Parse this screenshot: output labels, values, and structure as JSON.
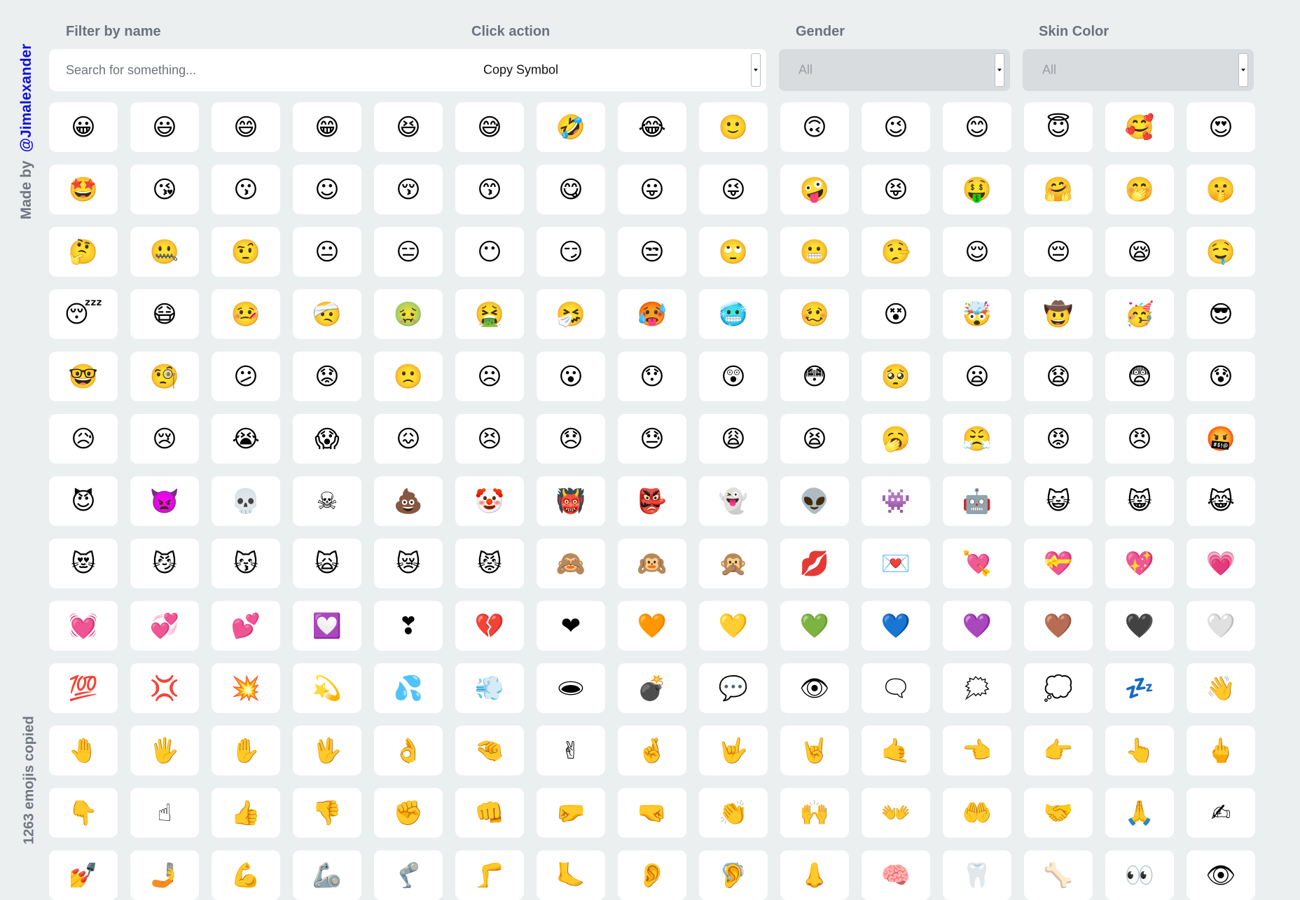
{
  "sidebar": {
    "made_by": "Made by",
    "handle": "@Jimalexander",
    "copied_count": "1263 emojis copied"
  },
  "filters": {
    "filter_label": "Filter by name",
    "search_placeholder": "Search for something...",
    "click_action_label": "Click action",
    "click_action_value": "Copy Symbol",
    "gender_label": "Gender",
    "gender_value": "All",
    "skin_label": "Skin Color",
    "skin_value": "All"
  },
  "emojis": [
    "😀",
    "😃",
    "😄",
    "😁",
    "😆",
    "😅",
    "🤣",
    "😂",
    "🙂",
    "🙃",
    "😉",
    "😊",
    "😇",
    "🥰",
    "😍",
    "🤩",
    "😘",
    "😗",
    "☺",
    "😚",
    "😙",
    "😋",
    "😛",
    "😜",
    "🤪",
    "😝",
    "🤑",
    "🤗",
    "🤭",
    "🤫",
    "🤔",
    "🤐",
    "🤨",
    "😐",
    "😑",
    "😶",
    "😏",
    "😒",
    "🙄",
    "😬",
    "🤥",
    "😌",
    "😔",
    "😪",
    "🤤",
    "😴",
    "😷",
    "🤒",
    "🤕",
    "🤢",
    "🤮",
    "🤧",
    "🥵",
    "🥶",
    "🥴",
    "😵",
    "🤯",
    "🤠",
    "🥳",
    "😎",
    "🤓",
    "🧐",
    "😕",
    "😟",
    "🙁",
    "☹",
    "😮",
    "😯",
    "😲",
    "😳",
    "🥺",
    "😦",
    "😧",
    "😨",
    "😰",
    "😥",
    "😢",
    "😭",
    "😱",
    "😖",
    "😣",
    "😞",
    "😓",
    "😩",
    "😫",
    "🥱",
    "😤",
    "😡",
    "😠",
    "🤬",
    "😈",
    "👿",
    "💀",
    "☠",
    "💩",
    "🤡",
    "👹",
    "👺",
    "👻",
    "👽",
    "👾",
    "🤖",
    "😺",
    "😸",
    "😹",
    "😻",
    "😼",
    "😽",
    "🙀",
    "😿",
    "😾",
    "🙈",
    "🙉",
    "🙊",
    "💋",
    "💌",
    "💘",
    "💝",
    "💖",
    "💗",
    "💓",
    "💞",
    "💕",
    "💟",
    "❣",
    "💔",
    "❤",
    "🧡",
    "💛",
    "💚",
    "💙",
    "💜",
    "🤎",
    "🖤",
    "🤍",
    "💯",
    "💢",
    "💥",
    "💫",
    "💦",
    "💨",
    "🕳",
    "💣",
    "💬",
    "👁",
    "🗨",
    "🗯",
    "💭",
    "💤",
    "👋",
    "🤚",
    "🖐",
    "✋",
    "🖖",
    "👌",
    "🤏",
    "✌",
    "🤞",
    "🤟",
    "🤘",
    "🤙",
    "👈",
    "👉",
    "👆",
    "🖕",
    "👇",
    "☝",
    "👍",
    "👎",
    "✊",
    "👊",
    "🤛",
    "🤜",
    "👏",
    "🙌",
    "👐",
    "🤲",
    "🤝",
    "🙏",
    "✍",
    "💅",
    "🤳",
    "💪",
    "🦾",
    "🦿",
    "🦵",
    "🦶",
    "👂",
    "🦻",
    "👃",
    "🧠",
    "🦷",
    "🦴",
    "👀",
    "👁"
  ]
}
